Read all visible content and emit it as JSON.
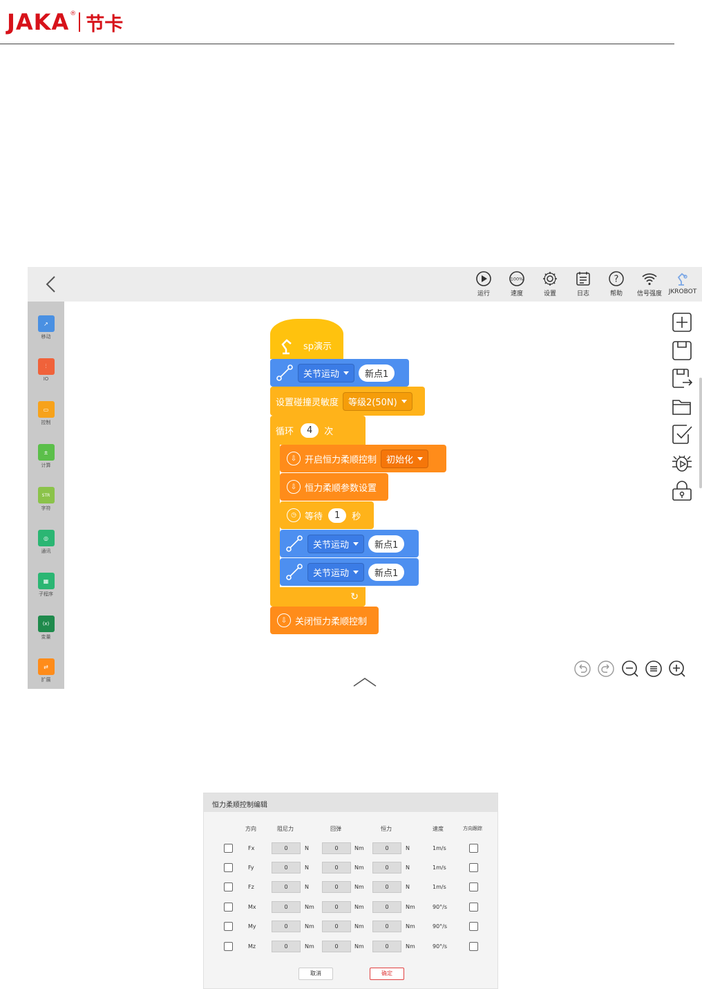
{
  "header": {
    "logo_latin": "JAKA",
    "logo_reg": "®",
    "logo_chinese": "节卡"
  },
  "topbar": {
    "items": [
      {
        "label": "运行",
        "icon": "play-icon"
      },
      {
        "label": "速度",
        "icon": "speed-gauge-icon",
        "badge": "100%"
      },
      {
        "label": "设置",
        "icon": "gear-icon"
      },
      {
        "label": "日志",
        "icon": "log-icon"
      },
      {
        "label": "帮助",
        "icon": "help-icon"
      },
      {
        "label": "信号强度",
        "icon": "wifi-icon"
      },
      {
        "label": "JKROBOT",
        "icon": "robot-arm-icon"
      }
    ]
  },
  "sidebar": {
    "items": [
      {
        "label": "移动",
        "color": "#4a90e2",
        "glyph": "↗"
      },
      {
        "label": "IO",
        "color": "#f0623a",
        "glyph": "⫶"
      },
      {
        "label": "控制",
        "color": "#f7a21b",
        "glyph": "▭"
      },
      {
        "label": "计算",
        "color": "#5bbf4a",
        "glyph": "±"
      },
      {
        "label": "字符",
        "color": "#8bc34a",
        "glyph": "STR"
      },
      {
        "label": "通讯",
        "color": "#2bb673",
        "glyph": "◎"
      },
      {
        "label": "子程序",
        "color": "#2bb673",
        "glyph": "▦"
      },
      {
        "label": "变量",
        "color": "#1f8a4c",
        "glyph": "(x)"
      },
      {
        "label": "扩展",
        "color": "#ff8c1a",
        "glyph": "⇄"
      }
    ]
  },
  "blocks": {
    "program_name": "sp演示",
    "move1": {
      "dropdown": "关节运动",
      "point": "新点1"
    },
    "collision": {
      "label": "设置碰撞灵敏度",
      "dropdown": "等级2(50N)"
    },
    "loop": {
      "label": "循环",
      "count": "4",
      "suffix": "次"
    },
    "force_on": {
      "label": "开启恒力柔顺控制",
      "dropdown": "初始化"
    },
    "force_params": {
      "label": "恒力柔顺参数设置"
    },
    "wait": {
      "label": "等待",
      "value": "1",
      "suffix": "秒"
    },
    "move2": {
      "dropdown": "关节运动",
      "point": "新点1"
    },
    "move3": {
      "dropdown": "关节运动",
      "point": "新点1"
    },
    "force_off": {
      "label": "关闭恒力柔顺控制"
    }
  },
  "dialog": {
    "title": "恒力柔顺控制编辑",
    "headers": {
      "direction": "方向",
      "damping": "阻尼力",
      "spring": "回弹",
      "force": "恒力",
      "speed": "速度",
      "tracking": "方向跟踪"
    },
    "rows": [
      {
        "dir": "Fx",
        "damping": "0",
        "damping_unit": "N",
        "spring": "0",
        "spring_unit": "Nm",
        "force": "0",
        "force_unit": "N",
        "speed": "1m/s"
      },
      {
        "dir": "Fy",
        "damping": "0",
        "damping_unit": "N",
        "spring": "0",
        "spring_unit": "Nm",
        "force": "0",
        "force_unit": "N",
        "speed": "1m/s"
      },
      {
        "dir": "Fz",
        "damping": "0",
        "damping_unit": "N",
        "spring": "0",
        "spring_unit": "Nm",
        "force": "0",
        "force_unit": "N",
        "speed": "1m/s"
      },
      {
        "dir": "Mx",
        "damping": "0",
        "damping_unit": "Nm",
        "spring": "0",
        "spring_unit": "Nm",
        "force": "0",
        "force_unit": "Nm",
        "speed": "90°/s"
      },
      {
        "dir": "My",
        "damping": "0",
        "damping_unit": "Nm",
        "spring": "0",
        "spring_unit": "Nm",
        "force": "0",
        "force_unit": "Nm",
        "speed": "90°/s"
      },
      {
        "dir": "Mz",
        "damping": "0",
        "damping_unit": "Nm",
        "spring": "0",
        "spring_unit": "Nm",
        "force": "0",
        "force_unit": "Nm",
        "speed": "90°/s"
      }
    ],
    "cancel_label": "取消",
    "confirm_label": "确定"
  }
}
